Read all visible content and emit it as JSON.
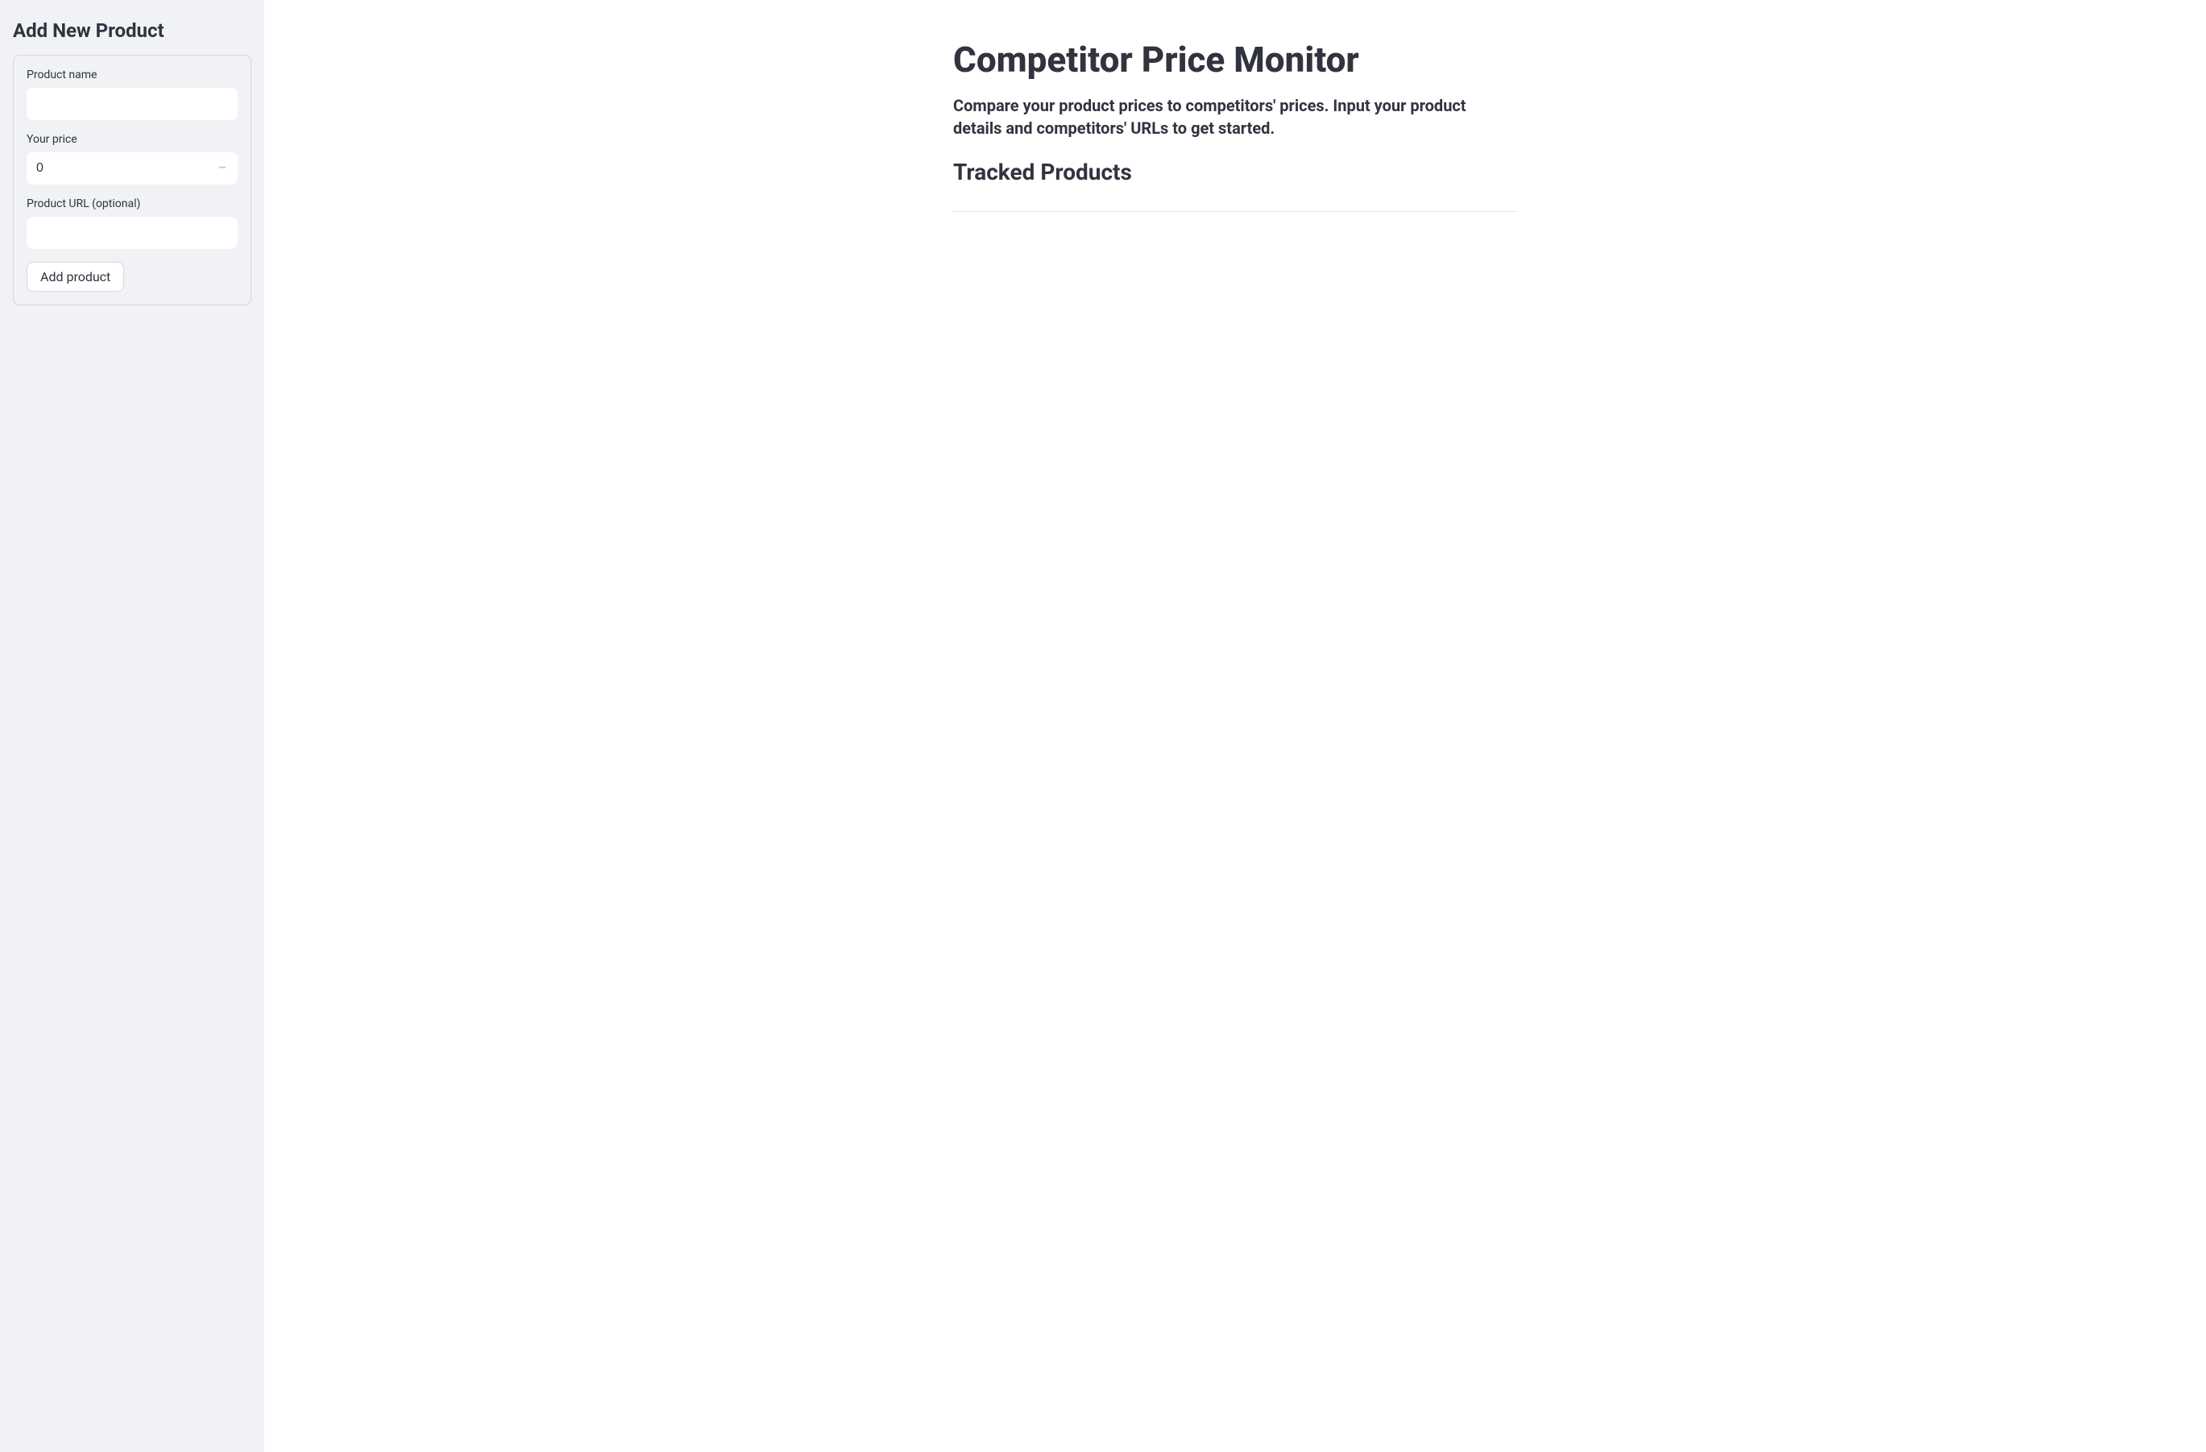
{
  "sidebar": {
    "heading": "Add New Product",
    "form": {
      "product_name": {
        "label": "Product name",
        "value": ""
      },
      "your_price": {
        "label": "Your price",
        "value": "0"
      },
      "product_url": {
        "label": "Product URL (optional)",
        "value": ""
      },
      "submit_button": "Add product"
    }
  },
  "main": {
    "title": "Competitor Price Monitor",
    "description": "Compare your product prices to competitors' prices. Input your product details and competitors' URLs to get started.",
    "section_heading": "Tracked Products"
  }
}
